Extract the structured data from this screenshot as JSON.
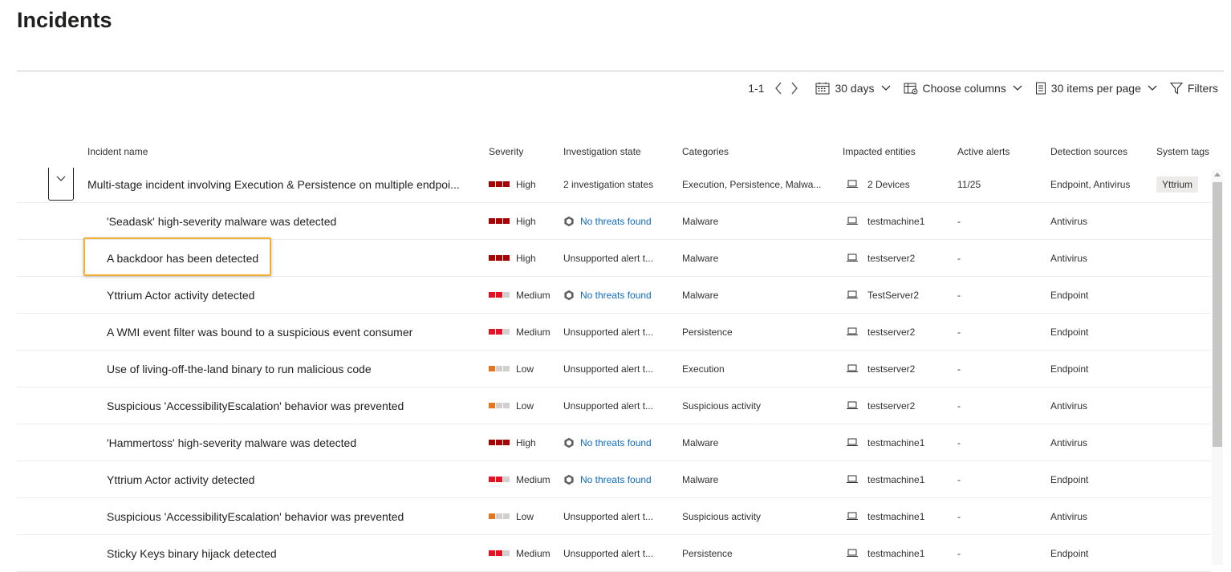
{
  "page": {
    "title": "Incidents"
  },
  "toolbar": {
    "paging": "1-1",
    "date_range": "30 days",
    "choose_columns": "Choose columns",
    "items_per_page": "30 items per page",
    "filters": "Filters"
  },
  "columns": {
    "name": "Incident name",
    "severity": "Severity",
    "investigation": "Investigation state",
    "categories": "Categories",
    "entities": "Impacted entities",
    "alerts": "Active alerts",
    "sources": "Detection sources",
    "tags": "System tags"
  },
  "colors": {
    "sev_high": "#a80000",
    "sev_medium": "#e81123",
    "sev_low": "#e8741c",
    "sev_empty": "#d2d0ce",
    "link": "#0f6cbd",
    "highlight": "#f2b134"
  },
  "incident": {
    "name": "Multi-stage incident involving Execution & Persistence on multiple endpoi...",
    "severity": "High",
    "investigation": "2 investigation states",
    "categories": "Execution, Persistence, Malwa...",
    "entities": "2 Devices",
    "alerts": "11/25",
    "sources": "Endpoint, Antivirus",
    "tag": "Yttrium"
  },
  "alerts": [
    {
      "name": "'Seadask' high-severity malware was detected",
      "severity": "High",
      "investigation": "No threats found",
      "category": "Malware",
      "entity": "testmachine1",
      "alerts": "-",
      "source": "Antivirus"
    },
    {
      "name": "A backdoor has been detected",
      "severity": "High",
      "investigation": "Unsupported alert t...",
      "category": "Malware",
      "entity": "testserver2",
      "alerts": "-",
      "source": "Antivirus"
    },
    {
      "name": "Yttrium Actor activity detected",
      "severity": "Medium",
      "investigation": "No threats found",
      "category": "Malware",
      "entity": "TestServer2",
      "alerts": "-",
      "source": "Endpoint"
    },
    {
      "name": "A WMI event filter was bound to a suspicious event consumer",
      "severity": "Medium",
      "investigation": "Unsupported alert t...",
      "category": "Persistence",
      "entity": "testserver2",
      "alerts": "-",
      "source": "Endpoint"
    },
    {
      "name": "Use of living-off-the-land binary to run malicious code",
      "severity": "Low",
      "investigation": "Unsupported alert t...",
      "category": "Execution",
      "entity": "testserver2",
      "alerts": "-",
      "source": "Endpoint"
    },
    {
      "name": "Suspicious 'AccessibilityEscalation' behavior was prevented",
      "severity": "Low",
      "investigation": "Unsupported alert t...",
      "category": "Suspicious activity",
      "entity": "testserver2",
      "alerts": "-",
      "source": "Antivirus"
    },
    {
      "name": "'Hammertoss' high-severity malware was detected",
      "severity": "High",
      "investigation": "No threats found",
      "category": "Malware",
      "entity": "testmachine1",
      "alerts": "-",
      "source": "Antivirus"
    },
    {
      "name": "Yttrium Actor activity detected",
      "severity": "Medium",
      "investigation": "No threats found",
      "category": "Malware",
      "entity": "testmachine1",
      "alerts": "-",
      "source": "Endpoint"
    },
    {
      "name": "Suspicious 'AccessibilityEscalation' behavior was prevented",
      "severity": "Low",
      "investigation": "Unsupported alert t...",
      "category": "Suspicious activity",
      "entity": "testmachine1",
      "alerts": "-",
      "source": "Antivirus"
    },
    {
      "name": "Sticky Keys binary hijack detected",
      "severity": "Medium",
      "investigation": "Unsupported alert t...",
      "category": "Persistence",
      "entity": "testmachine1",
      "alerts": "-",
      "source": "Endpoint"
    }
  ]
}
